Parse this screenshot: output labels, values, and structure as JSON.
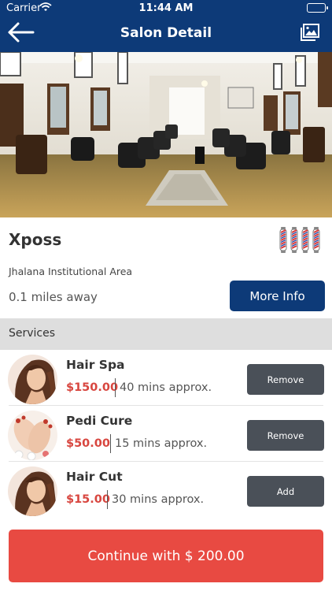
{
  "status_bar": {
    "carrier": "Carrier",
    "time": "11:44 AM"
  },
  "nav": {
    "title": "Salon Detail",
    "back_icon": "arrow-left-icon",
    "gallery_icon": "image-gallery-icon"
  },
  "salon": {
    "name": "Xposs",
    "area": "Jhalana Institutional Area",
    "distance": "0.1 miles away",
    "more_info_label": "More Info"
  },
  "services_header": "Services",
  "services": [
    {
      "name": "Hair Spa",
      "price": "$150.00",
      "duration": "40 mins approx.",
      "action": "Remove"
    },
    {
      "name": "Pedi Cure",
      "price": "$50.00",
      "duration": "15 mins approx.",
      "action": "Remove"
    },
    {
      "name": "Hair Cut",
      "price": "$15.00",
      "duration": "30 mins approx.",
      "action": "Add"
    }
  ],
  "continue_label": "Continue with $ 200.00",
  "colors": {
    "nav_blue": "#0d3a78",
    "price_red": "#d8463f",
    "continue_red": "#e84a42",
    "action_gray": "#4a5058",
    "section_gray": "#dedede"
  }
}
